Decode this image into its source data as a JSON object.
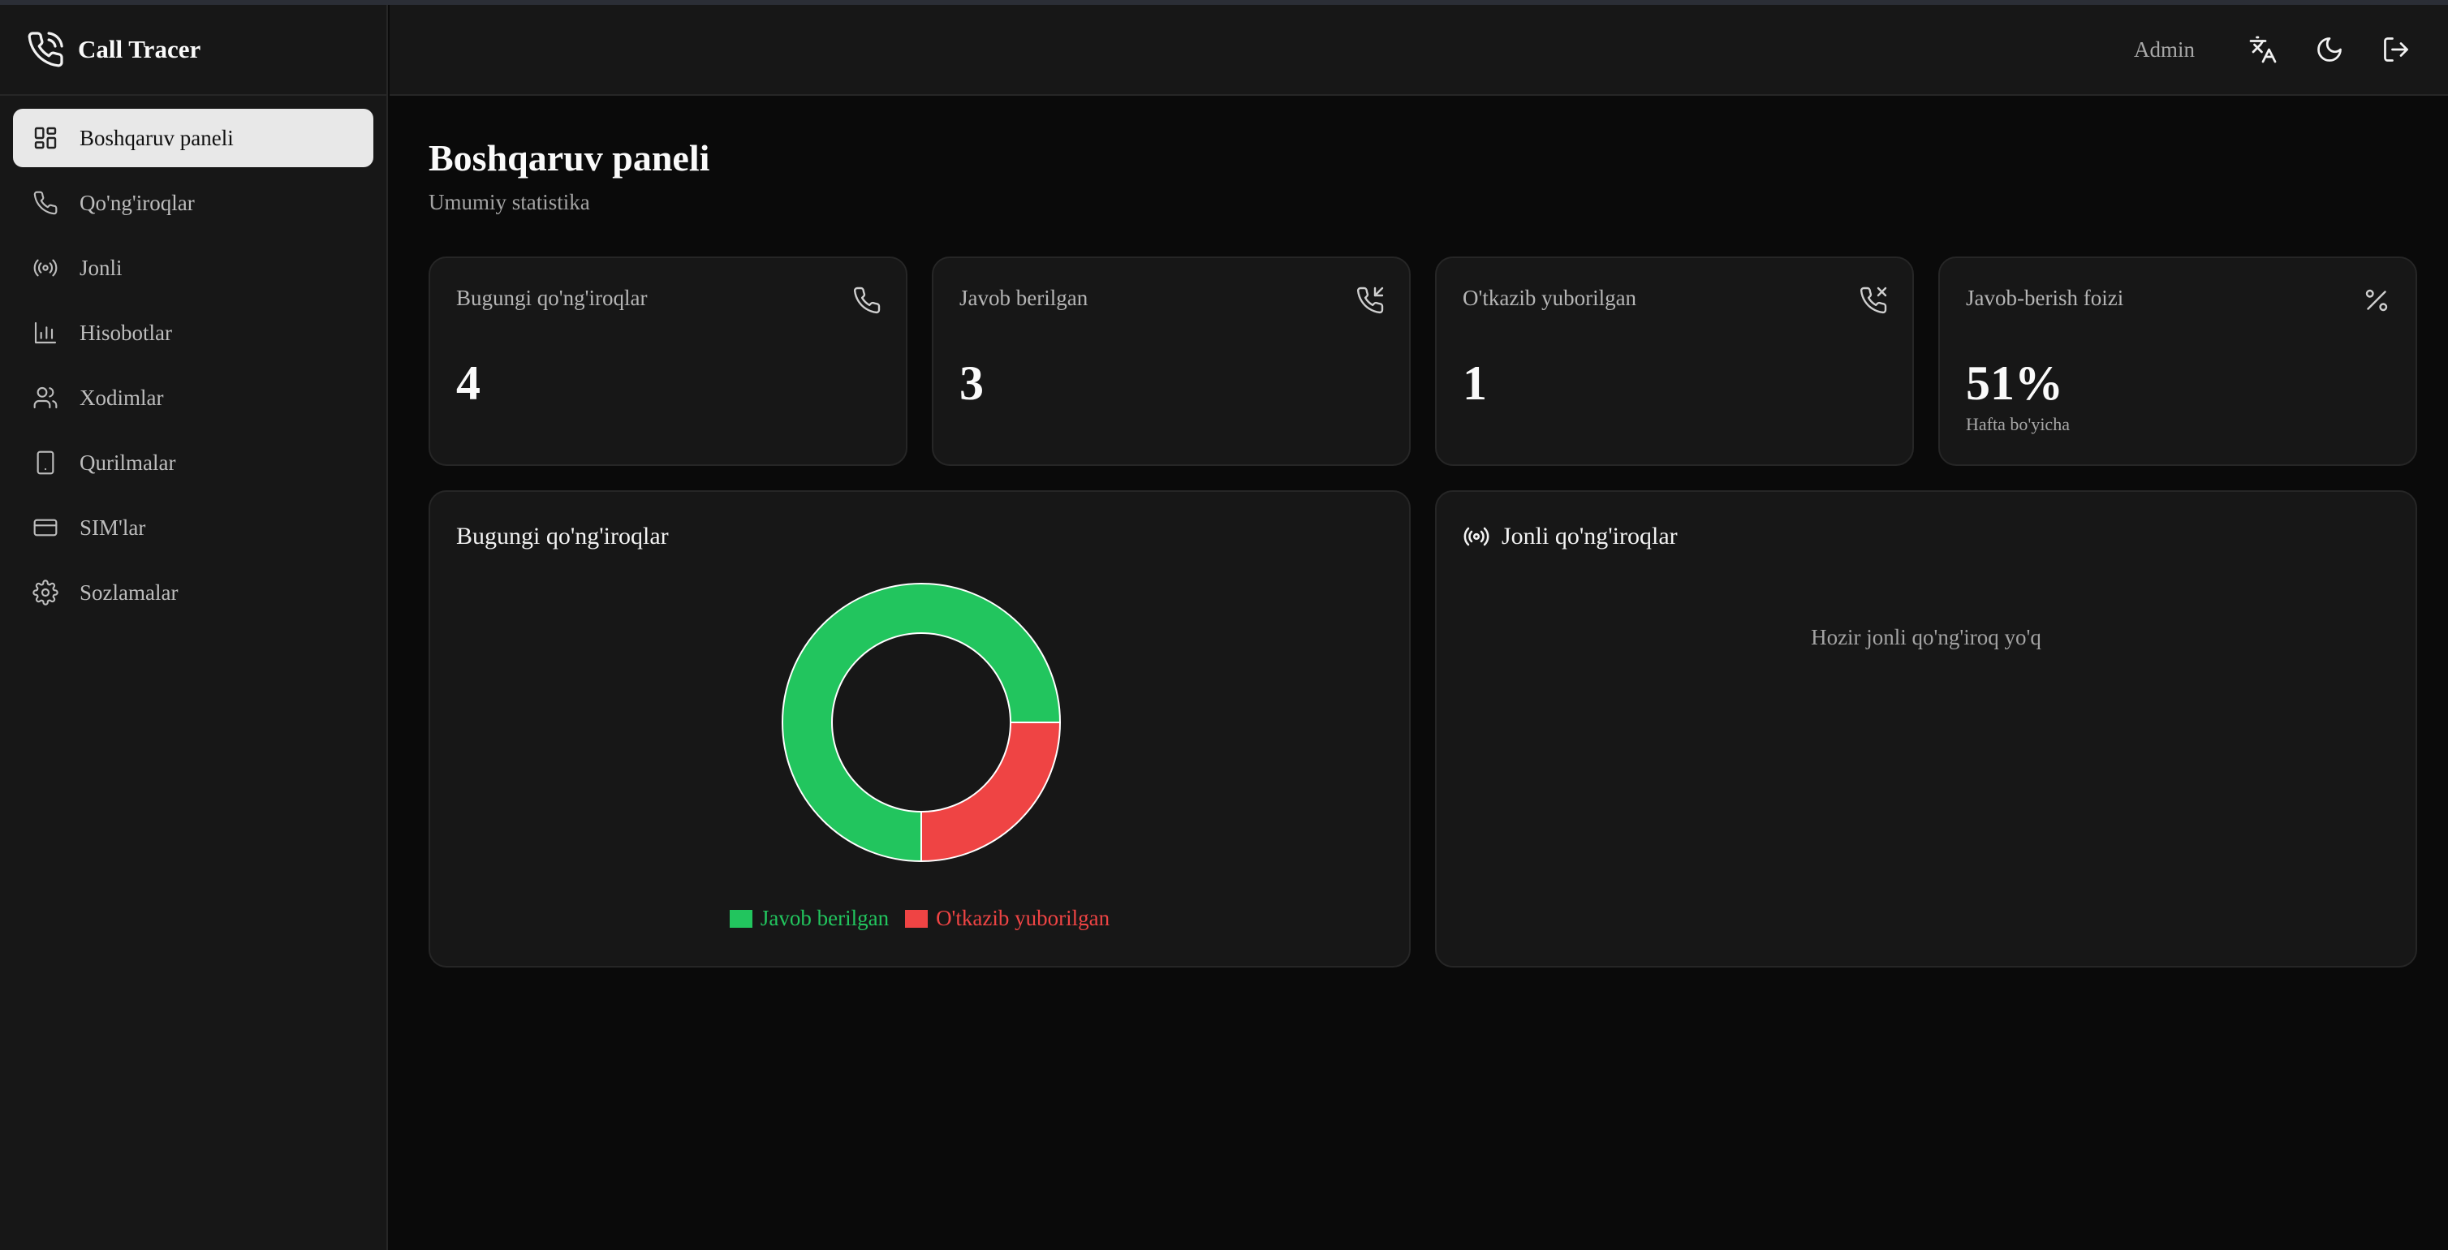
{
  "app": {
    "name": "Call Tracer"
  },
  "sidebar": {
    "items": [
      {
        "label": "Boshqaruv paneli",
        "icon": "dashboard-icon",
        "active": true
      },
      {
        "label": "Qo'ng'iroqlar",
        "icon": "phone-icon"
      },
      {
        "label": "Jonli",
        "icon": "radio-icon"
      },
      {
        "label": "Hisobotlar",
        "icon": "bar-chart-icon"
      },
      {
        "label": "Xodimlar",
        "icon": "users-icon"
      },
      {
        "label": "Qurilmalar",
        "icon": "smartphone-icon"
      },
      {
        "label": "SIM'lar",
        "icon": "credit-card-icon"
      },
      {
        "label": "Sozlamalar",
        "icon": "gear-icon"
      }
    ]
  },
  "header": {
    "user": "Admin",
    "icons": [
      "translate-icon",
      "moon-icon",
      "logout-icon"
    ]
  },
  "page": {
    "title": "Boshqaruv paneli",
    "subtitle": "Umumiy statistika"
  },
  "stats": [
    {
      "title": "Bugungi qo'ng'iroqlar",
      "value": "4",
      "icon": "phone-icon"
    },
    {
      "title": "Javob berilgan",
      "value": "3",
      "icon": "phone-incoming-icon"
    },
    {
      "title": "O'tkazib yuborilgan",
      "value": "1",
      "icon": "phone-missed-icon"
    },
    {
      "title": "Javob-berish foizi",
      "value": "51%",
      "footnote": "Hafta bo'yicha",
      "icon": "percent-icon"
    }
  ],
  "today_panel": {
    "title": "Bugungi qo'ng'iroqlar"
  },
  "live_panel": {
    "title": "Jonli qo'ng'iroqlar",
    "empty_text": "Hozir jonli qo'ng'iroq yo'q",
    "icon": "radio-icon"
  },
  "chart_data": {
    "type": "pie",
    "categories": [
      "Javob berilgan",
      "O'tkazib yuborilgan"
    ],
    "values": [
      3,
      1
    ],
    "colors": [
      "#22c55e",
      "#ef4444"
    ],
    "legend": "bottom"
  }
}
